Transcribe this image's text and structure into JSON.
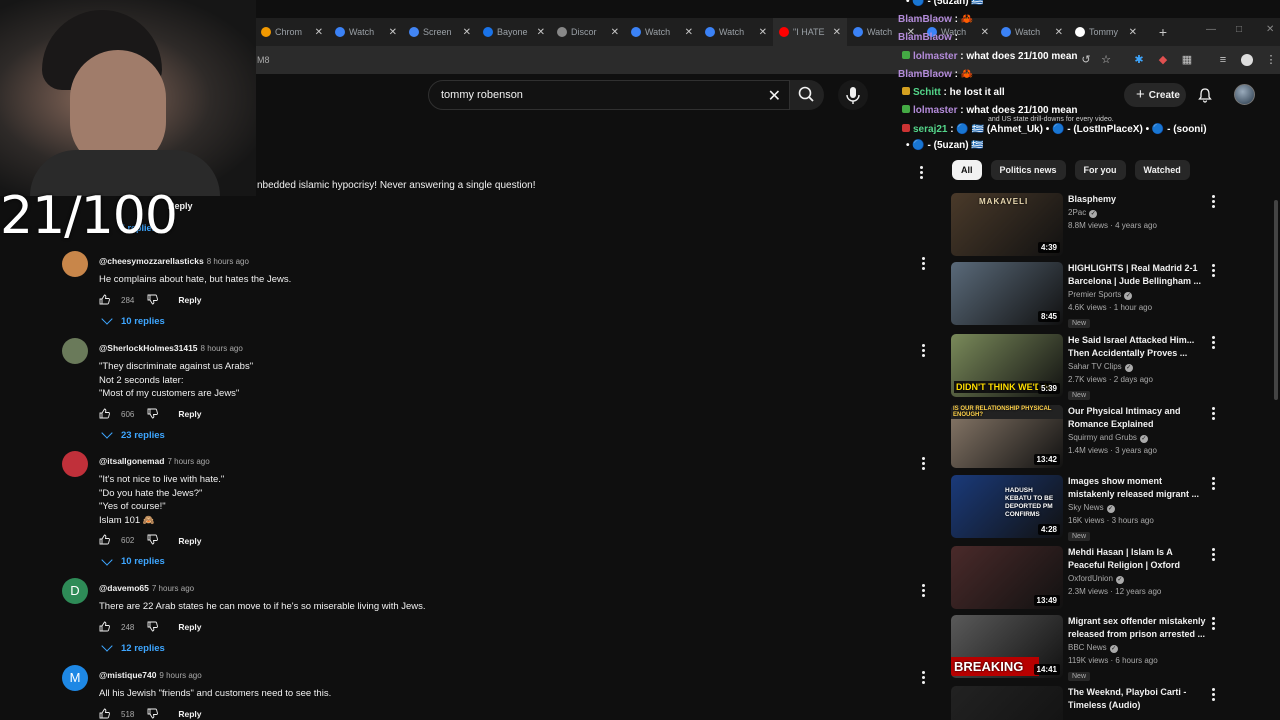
{
  "browser": {
    "tabs": [
      {
        "label": "Chrom",
        "color": "#f29900"
      },
      {
        "label": "Watch",
        "color": "#3b82f6"
      },
      {
        "label": "Screen",
        "color": "#4285f4"
      },
      {
        "label": "Bayone",
        "color": "#1a73e8"
      },
      {
        "label": "Discor",
        "color": "#888888"
      },
      {
        "label": "Watch",
        "color": "#3b82f6"
      },
      {
        "label": "Watch",
        "color": "#3b82f6"
      },
      {
        "label": "\"I HATE",
        "color": "#ff0000"
      },
      {
        "label": "Watch",
        "color": "#3b82f6"
      },
      {
        "label": "Watch",
        "color": "#3b82f6"
      },
      {
        "label": "Watch",
        "color": "#3b82f6"
      },
      {
        "label": "Tommy",
        "color": "#ffffff"
      }
    ],
    "new_tab_glyph": "+",
    "url_fragment": "M8"
  },
  "youtube": {
    "search_query": "tommy robenson",
    "create_label": "Create",
    "chips": [
      "All",
      "Politics news",
      "For you",
      "Watched"
    ]
  },
  "stream": {
    "score": "21/100"
  },
  "partial_comment": {
    "text": "nbedded islamic hypocrisy! Never answering a single question!",
    "reply": "Reply",
    "replies": "5 replies"
  },
  "comments": [
    {
      "handle": "@cheesymozzarellasticks",
      "time": "8 hours ago",
      "text": "He complains about hate, but hates the Jews.",
      "likes": "284",
      "reply": "Reply",
      "replies": "10 replies",
      "avatar_initial": "",
      "avatar_color": "#c8864a"
    },
    {
      "handle": "@SherlockHolmes31415",
      "time": "8 hours ago",
      "text": "\"They discriminate against us Arabs\"\nNot 2 seconds later:\n\"Most of my customers are Jews\"",
      "likes": "606",
      "reply": "Reply",
      "replies": "23 replies",
      "avatar_initial": "",
      "avatar_color": "#6a7a5a"
    },
    {
      "handle": "@itsallgonemad",
      "time": "7 hours ago",
      "text": "\"It's not nice to live with hate.\"\n\"Do you hate the Jews?\"\n\"Yes of course!\"\nIslam 101 🙈",
      "likes": "602",
      "reply": "Reply",
      "replies": "10 replies",
      "avatar_initial": "",
      "avatar_color": "#c0303a"
    },
    {
      "handle": "@davemo65",
      "time": "7 hours ago",
      "text": "There are 22 Arab states he can move to if he's so miserable living with Jews.",
      "likes": "248",
      "reply": "Reply",
      "replies": "12 replies",
      "avatar_initial": "D",
      "avatar_color": "#2e8b57"
    },
    {
      "handle": "@mistique740",
      "time": "9 hours ago",
      "text": "All his Jewish \"friends\" and customers need to see this.",
      "likes": "518",
      "reply": "Reply",
      "replies": "",
      "avatar_initial": "M",
      "avatar_color": "#1e88e5"
    }
  ],
  "videos": [
    {
      "title": "Blasphemy",
      "channel": "2Pac",
      "meta": "8.8M views · 4 years ago",
      "duration": "4:39",
      "badge": "",
      "thumb_text": "MAKAVELI",
      "thumb_bg": "#4a3a2a"
    },
    {
      "title": "HIGHLIGHTS | Real Madrid 2-1 Barcelona | Jude Bellingham ...",
      "channel": "Premier Sports",
      "meta": "4.6K views · 1 hour ago",
      "duration": "8:45",
      "badge": "New",
      "thumb_text": "",
      "thumb_bg": "#5a6a7a"
    },
    {
      "title": "He Said Israel Attacked Him... Then Accidentally Proves ...",
      "channel": "Sahar TV Clips",
      "meta": "2.7K views · 2 days ago",
      "duration": "5:39",
      "badge": "New",
      "thumb_text": "DIDN'T THINK WE'D N",
      "thumb_bg": "#7a8a5a"
    },
    {
      "title": "Our Physical Intimacy and Romance Explained",
      "channel": "Squirmy and Grubs",
      "meta": "1.4M views · 3 years ago",
      "duration": "13:42",
      "badge": "",
      "thumb_text": "IS OUR RELATIONSHIP PHYSICAL ENOUGH?",
      "thumb_bg": "#8a7a6a"
    },
    {
      "title": "Images show moment mistakenly released migrant ...",
      "channel": "Sky News",
      "meta": "16K views · 3 hours ago",
      "duration": "4:28",
      "badge": "New",
      "thumb_text": "HADUSH KEBATU TO BE DEPORTED PM CONFIRMS",
      "thumb_bg": "#1a3a7a"
    },
    {
      "title": "Mehdi Hasan | Islam Is A Peaceful Religion | Oxford Union",
      "channel": "OxfordUnion",
      "meta": "2.3M views · 12 years ago",
      "duration": "13:49",
      "badge": "",
      "thumb_text": "",
      "thumb_bg": "#4a2a2a"
    },
    {
      "title": "Migrant sex offender mistakenly released from prison arrested ...",
      "channel": "BBC News",
      "meta": "119K views · 6 hours ago",
      "duration": "14:41",
      "badge": "New",
      "thumb_text": "BREAKING",
      "thumb_bg": "#5a5a5a"
    },
    {
      "title": "The Weeknd, Playboi Carti - Timeless (Audio)",
      "channel": "",
      "meta": "",
      "duration": "",
      "badge": "",
      "thumb_text": "",
      "thumb_bg": "#222222"
    }
  ],
  "chat": {
    "lines": [
      {
        "name": "",
        "msg": "• 🔵 - (5uzan) 🇬🇷",
        "name_color": "purple",
        "badge": ""
      },
      {
        "name": "BlamBlaow",
        "msg": ": 🦀",
        "name_color": "purple",
        "badge": ""
      },
      {
        "name": "BlamBlaow",
        "msg": ":",
        "name_color": "purple",
        "badge": ""
      },
      {
        "name": "lolmaster",
        "msg": ": what does 21/100 mean",
        "name_color": "purple",
        "badge": "#4a4"
      },
      {
        "name": "BlamBlaow",
        "msg": ": 🦀",
        "name_color": "purple",
        "badge": ""
      },
      {
        "name": "Schitt",
        "msg": ": he lost it all",
        "name_color": "green",
        "badge": "#d4a020"
      },
      {
        "name": "lolmaster",
        "msg": ": what does 21/100 mean",
        "name_color": "purple",
        "badge": "#4a4"
      },
      {
        "name": "seraj21",
        "msg": ": 🔵 🇬🇷 (Ahmet_Uk) • 🔵 - (LostInPlaceX) • 🔵 - (sooni)",
        "name_color": "green",
        "badge": "#c33"
      },
      {
        "name": "",
        "msg": "• 🔵 - (5uzan) 🇬🇷",
        "name_color": "purple",
        "badge": ""
      }
    ],
    "overlay_note": "and US state drill-downs for every video."
  }
}
